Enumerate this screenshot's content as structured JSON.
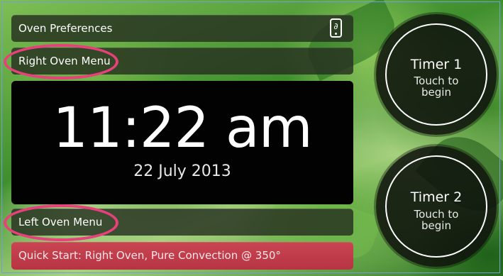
{
  "menu": {
    "preferences_label": "Oven Preferences",
    "right_oven_label": "Right Oven Menu",
    "left_oven_label": "Left Oven Menu",
    "quick_start_label": "Quick Start: Right Oven, Pure Convection @ 350°",
    "preferences_icon": "phone-icon"
  },
  "clock": {
    "time": "11:22 am",
    "date": "22 July 2013"
  },
  "timers": [
    {
      "title": "Timer 1",
      "subtitle": "Touch to begin"
    },
    {
      "title": "Timer 2",
      "subtitle": "Touch to begin"
    }
  ],
  "colors": {
    "highlight": "#e8407a",
    "quick_start": "#c94552",
    "panel": "#020202"
  }
}
